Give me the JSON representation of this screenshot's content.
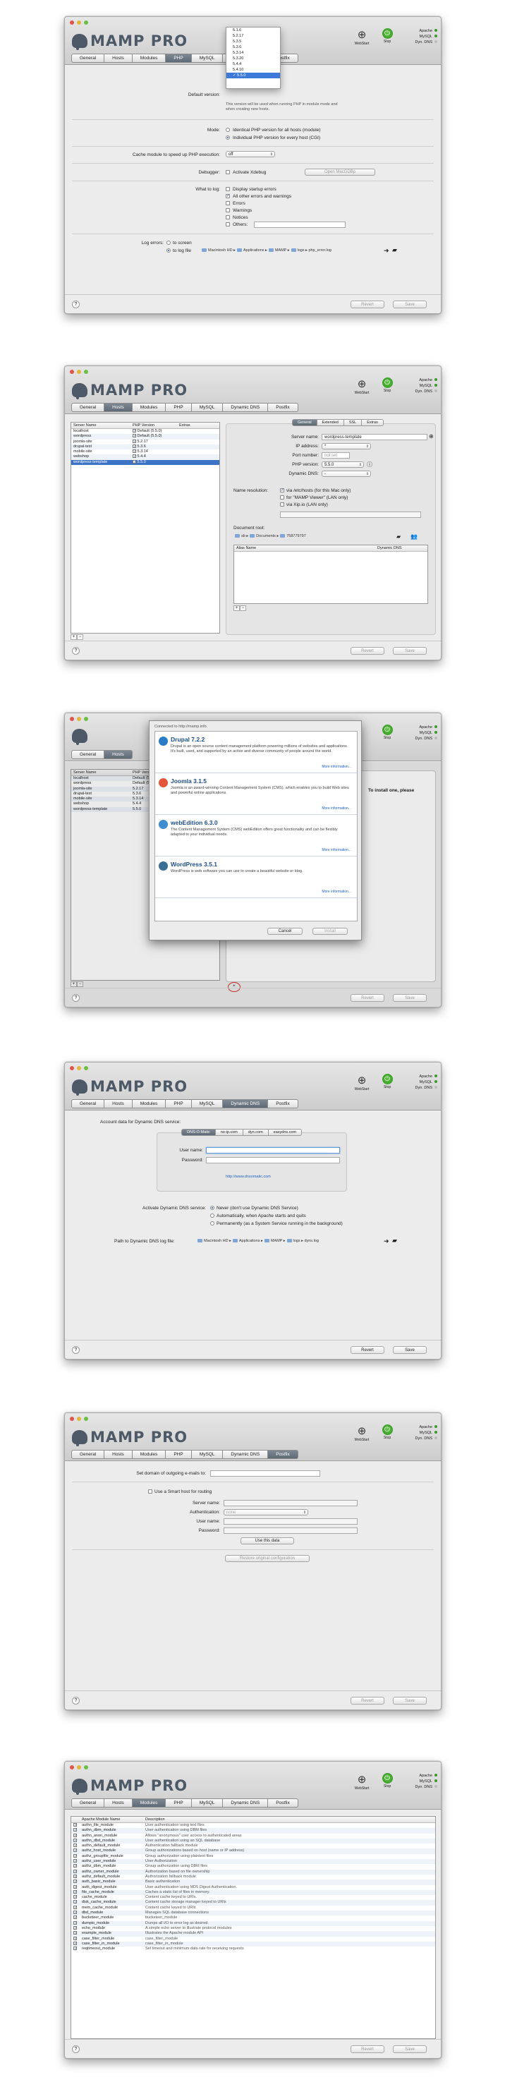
{
  "common": {
    "logo": "MAMP PRO",
    "webstart": "WebStart",
    "stop": "Stop",
    "apache": "Apache",
    "mysql": "MySQL",
    "dyndns": "Dyn. DNS",
    "revert": "Revert",
    "save": "Save",
    "help": "?",
    "tabs": [
      "General",
      "Hosts",
      "Modules",
      "PHP",
      "MySQL",
      "Dynamic DNS",
      "Postfix"
    ]
  },
  "colors": {
    "selected_tab": "#6a7480",
    "selection": "#3c73c4",
    "status_green": "#3b9a2a",
    "link": "#1d62c4"
  },
  "php": {
    "dropdown": [
      "5.1.6",
      "5.2.17",
      "5.3.5",
      "5.3.6",
      "5.3.14",
      "5.3.20",
      "5.4.4",
      "5.4.10",
      "5.5.0"
    ],
    "dropdown_selected": "5.5.0",
    "default_version_label": "Default version:",
    "note": "This version will be used when running PHP in module mode and when creating new hosts.",
    "mode_label": "Mode:",
    "mode_opt1": "Identical PHP version for all hosts (module)",
    "mode_opt2": "Individual PHP version for every host (CGI)",
    "cache_label": "Cache module to speed up PHP execution:",
    "cache_value": "off",
    "debugger_label": "Debugger:",
    "debugger_opt": "Activate Xdebug",
    "open_btn": "Open MacGDBp",
    "log_label": "What to log:",
    "log_opts": [
      "Display startup errors",
      "All other errors and warnings",
      "Errors",
      "Warnings",
      "Notices",
      "Others:"
    ],
    "log_errors_label": "Log errors:",
    "to_screen": "to screen",
    "to_log": "to log file",
    "log_path": [
      "Macintosh HD",
      "Applications",
      "MAMP",
      "logs",
      "php_error.log"
    ]
  },
  "hosts": {
    "cols": [
      "Server Name",
      "PHP Version",
      "Extras"
    ],
    "rows": [
      {
        "name": "localhost",
        "php": "Default (5.5.0)"
      },
      {
        "name": "wordpress",
        "php": "Default (5.5.0)"
      },
      {
        "name": "joomla-site",
        "php": "5.2.17"
      },
      {
        "name": "drupal-test",
        "php": "5.3.6"
      },
      {
        "name": "mobile-site",
        "php": "5.3.14"
      },
      {
        "name": "webshop",
        "php": "5.4.4"
      },
      {
        "name": "wordpress-template",
        "php": "5.5.0"
      }
    ],
    "subtabs": [
      "General",
      "Extended",
      "SSL",
      "Extras"
    ],
    "server_name_label": "Server name:",
    "server_name": "wordpress-template",
    "ip_label": "IP address:",
    "ip_value": "*",
    "port_label": "Port number:",
    "port_value": "not set",
    "php_label": "PHP version:",
    "php_value": "5.5.0",
    "dyndns_label": "Dynamic DNS:",
    "dyndns_value": "-",
    "nameres_label": "Name resolution:",
    "nameres_opts": [
      "via /etc/hosts (for this Mac only)",
      "for \"MAMP Viewer\" (LAN only)",
      "via Xip.io (LAN only)"
    ],
    "docroot_label": "Document root:",
    "docroot_path": [
      "sb",
      "Documents",
      "758779797"
    ],
    "alias_cols": [
      "Alias Name",
      "Dynamic DNS"
    ]
  },
  "sheet": {
    "header": "Connected to http://mamp.info.",
    "to_install": "To install one, please",
    "cancel": "Cancel",
    "install": "Install",
    "more": "More information...",
    "apps": [
      {
        "title": "Drupal 7.2.2",
        "desc": "Drupal is an open source content management platform powering millions of websites and applications. It's built, used, and supported by an active and diverse community of people around the world.",
        "color": "#2a7bc5"
      },
      {
        "title": "Joomla 3.1.5",
        "desc": "Joomla is an award-winning Content Management System (CMS), which enables you to build Web sites and powerful online applications.",
        "color": "#e2573a"
      },
      {
        "title": "webEdition 6.3.0",
        "desc": "The Content Management System (CMS) webEdition offers great functionality and can be flexibly adapted to your individual needs.",
        "color": "#3e8ed0"
      },
      {
        "title": "WordPress 3.5.1",
        "desc": "WordPress is web software you can use to create a beautiful website or blog.",
        "color": "#3b6e95"
      }
    ]
  },
  "dyn": {
    "account_label": "Account data for Dynamic DNS service:",
    "services": [
      "DNS-O-Matic",
      "no-ip.com",
      "dyn.com",
      "easydns.com"
    ],
    "user_label": "User name:",
    "pass_label": "Password:",
    "link": "http://www.dnsomatic.com",
    "activate_label": "Activate Dynamic DNS service:",
    "opts": [
      "Never (don't use Dynamic DNS Service)",
      "Automatically, when Apache starts and quits",
      "Permanently (as a System Service running in the background)"
    ],
    "logpath_label": "Path to Dynamic DNS log file:",
    "log_path": [
      "Macintosh HD",
      "Applications",
      "MAMP",
      "logs",
      "dyns.log"
    ]
  },
  "postfix": {
    "domain_label": "Set domain of outgoing e-mails to:",
    "smart_label": "Use a Smart host for routing",
    "server_label": "Server name:",
    "auth_label": "Authentication:",
    "auth_value": "none",
    "user_label": "User name:",
    "pass_label": "Password:",
    "use_btn": "Use this data",
    "restore_btn": "Restore original configuration"
  },
  "modules": {
    "cols": [
      "Apache Module Name",
      "Description"
    ],
    "rows": [
      [
        "authn_file_module",
        "User authentication using text files"
      ],
      [
        "authn_dbm_module",
        "User authentication using DBM files"
      ],
      [
        "authn_anon_module",
        "Allows \"anonymous\" user access to authenticated areas"
      ],
      [
        "authn_dbd_module",
        "User authentication using an SQL database"
      ],
      [
        "authn_default_module",
        "Authentication fallback module"
      ],
      [
        "authz_host_module",
        "Group authorizations based on host (name or IP address)"
      ],
      [
        "authz_groupfile_module",
        "Group authorization using plaintext files"
      ],
      [
        "authz_user_module",
        "User Authorization"
      ],
      [
        "authz_dbm_module",
        "Group authorization using DBM files"
      ],
      [
        "authz_owner_module",
        "Authorization based on file ownership"
      ],
      [
        "authz_default_module",
        "Authorization fallback module"
      ],
      [
        "auth_basic_module",
        "Basic authentication"
      ],
      [
        "auth_digest_module",
        "User authentication using MD5 Digest Authentication."
      ],
      [
        "file_cache_module",
        "Caches a static list of files in memory."
      ],
      [
        "cache_module",
        "Content cache keyed to URIs."
      ],
      [
        "disk_cache_module",
        "Content cache storage manager keyed to URIs"
      ],
      [
        "mem_cache_module",
        "Content cache keyed to URIs"
      ],
      [
        "dbd_module",
        "Manages SQL database connections"
      ],
      [
        "bucketeer_module",
        "bucketeer_module"
      ],
      [
        "dumpio_module",
        "Dumps all I/O to error log as desired."
      ],
      [
        "echo_module",
        "A simple echo server to illustrate protocol modules"
      ],
      [
        "example_module",
        "Illustrates the Apache module API"
      ],
      [
        "case_filter_module",
        "case_filter_module"
      ],
      [
        "case_filter_in_module",
        "case_filter_in_module"
      ],
      [
        "reqtimeout_module",
        "Set timeout and minimum data rate for receiving requests"
      ]
    ]
  }
}
